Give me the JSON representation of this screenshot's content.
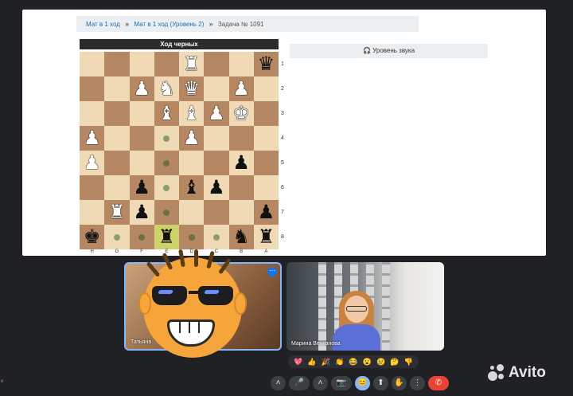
{
  "breadcrumb": {
    "items": [
      "Мат в 1 ход",
      "Мат в 1 ход (Уровень 2)"
    ],
    "current": "Задача № 1091",
    "separator": "»"
  },
  "board": {
    "turn_label": "Ход черных",
    "rank_labels": [
      "1",
      "2",
      "3",
      "4",
      "5",
      "6",
      "7",
      "8"
    ],
    "file_labels": [
      "H",
      "G",
      "F",
      "E",
      "D",
      "C",
      "B",
      "A"
    ],
    "rows": [
      [
        "",
        "",
        "",
        "",
        "wR",
        "",
        "",
        "bQ"
      ],
      [
        "",
        "",
        "wP",
        "wN",
        "wQ",
        "",
        "wP",
        ""
      ],
      [
        "",
        "",
        "",
        "wB",
        "wB",
        "wP",
        "wK",
        ""
      ],
      [
        "wP",
        "",
        "",
        ".",
        "wP",
        "",
        "",
        ""
      ],
      [
        "wP",
        "",
        "",
        ".",
        "",
        "",
        "bP",
        ""
      ],
      [
        "",
        "",
        "bP",
        ".",
        "bB",
        "bP",
        "",
        ""
      ],
      [
        "",
        "wR",
        "bP",
        ".",
        "",
        "",
        "",
        "bP"
      ],
      [
        "bK",
        ".",
        ".",
        "bR",
        ".",
        ".",
        "bN",
        "bR"
      ]
    ],
    "highlight": [
      [
        7,
        3
      ]
    ],
    "colors": {
      "light": "#f0d9b5",
      "dark": "#b58863"
    }
  },
  "sound": {
    "icon": "headphones-icon",
    "label": "Уровень звука"
  },
  "participants": [
    {
      "name": "Татьяна"
    },
    {
      "name": "Марина Вечканова"
    }
  ],
  "reactions": [
    "💖",
    "👍",
    "🎉",
    "👏",
    "😂",
    "😮",
    "😢",
    "🤔",
    "👎"
  ],
  "controls": [
    "˄",
    "🎤",
    "˄",
    "📷",
    "😊",
    "⬆",
    "✋",
    "⋮",
    "✆"
  ],
  "watermark": "Avito",
  "side_letter": "v"
}
